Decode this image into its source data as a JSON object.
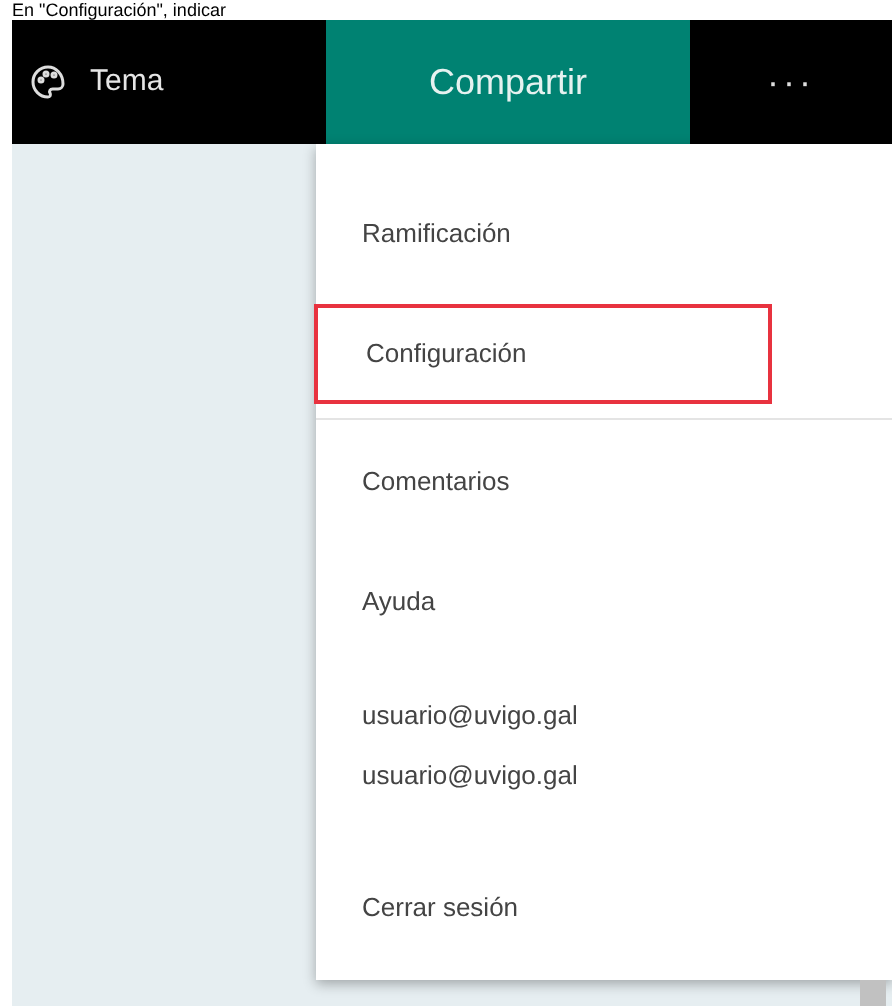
{
  "caption": "En \"Configuración\", indicar",
  "toolbar": {
    "theme_label": "Tema",
    "share_label": "Compartir",
    "more_label": "···"
  },
  "menu": {
    "items": [
      {
        "kind": "item",
        "label": "Ramificación",
        "highlighted": false
      },
      {
        "kind": "item",
        "label": "Configuración",
        "highlighted": true
      },
      {
        "kind": "divider"
      },
      {
        "kind": "item",
        "label": "Comentarios",
        "highlighted": false
      },
      {
        "kind": "item",
        "label": "Ayuda",
        "highlighted": false
      },
      {
        "kind": "account",
        "lines": [
          "usuario@uvigo.gal",
          "usuario@uvigo.gal"
        ]
      },
      {
        "kind": "item",
        "label": "Cerrar sesión",
        "highlighted": false
      }
    ]
  }
}
